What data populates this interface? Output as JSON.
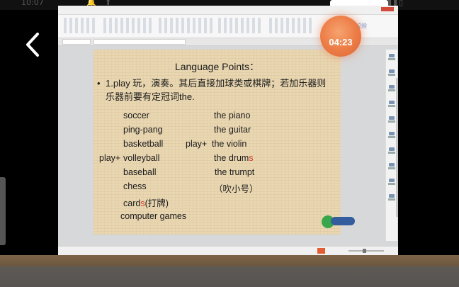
{
  "status_bar": {
    "time": "10:07",
    "right_icons": "5G ▮▮▯"
  },
  "timer": {
    "value": "04:23"
  },
  "app": {
    "cloud_label": "阅识校验"
  },
  "slide": {
    "title": "Language Points：",
    "bullet": "•",
    "intro_prefix": "1.play 玩，演奏。其后直接加球类或棋牌；若加乐器则乐器前要有定冠词",
    "intro_highlight": "the.",
    "left_items": [
      {
        "label": "soccer",
        "suffix": ""
      },
      {
        "label": "ping-pang",
        "suffix": ""
      },
      {
        "label": "basketball",
        "suffix": ""
      },
      {
        "label": "volleyball",
        "suffix": ""
      },
      {
        "label": "baseball",
        "suffix": ""
      },
      {
        "label": "chess",
        "suffix": ""
      },
      {
        "label": "card",
        "suffix": "s",
        "note": "(打牌)"
      },
      {
        "label": "computer games",
        "suffix": ""
      }
    ],
    "play_label_left": "play+",
    "play_label_right": "play+",
    "right_items": [
      {
        "label": "the piano",
        "suffix": ""
      },
      {
        "label": "the guitar",
        "suffix": ""
      },
      {
        "label": "the violin",
        "suffix": ""
      },
      {
        "label": "the drum",
        "suffix": "s"
      },
      {
        "label": "the trumpt",
        "suffix": ""
      },
      {
        "label": "（吹小号）",
        "suffix": ""
      }
    ]
  }
}
